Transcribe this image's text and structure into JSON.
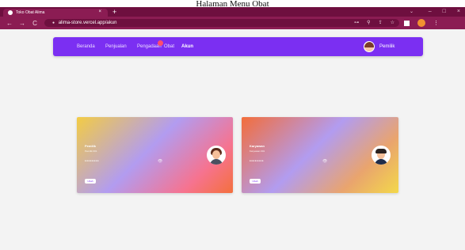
{
  "caption": "Halaman Menu Obat",
  "browser": {
    "tab_title": "Toko Obat Alima",
    "tab_close": "×",
    "new_tab": "+",
    "window_controls": [
      "⌄",
      "–",
      "□",
      "×"
    ],
    "back": "←",
    "forward": "→",
    "reload": "C",
    "url": "alima-store.vercel.app/akun",
    "omnibox_icons": [
      "⊶",
      "⚲",
      "⇪",
      "☆"
    ],
    "menu": "⋮"
  },
  "navbar": {
    "links": [
      "Beranda",
      "Penjualan",
      "Pengadaan",
      "Obat",
      "Akun"
    ],
    "active": "Akun",
    "user_name": "Pemilik"
  },
  "cards": [
    {
      "name": "Pemilik",
      "subtitle": "Pemilik 001",
      "password": "••••••••",
      "eye": "👁",
      "button": "Ubah",
      "avatar": "female"
    },
    {
      "name": "Karyawan",
      "subtitle": "Karyawan 001",
      "password": "••••••••",
      "eye": "👁",
      "button": "Ubah",
      "avatar": "male"
    }
  ],
  "colors": {
    "tabbar": "#6e0f3f",
    "addrbar": "#8b1c53",
    "navbar": "#7b2ff2",
    "background": "#f3f3f3"
  }
}
